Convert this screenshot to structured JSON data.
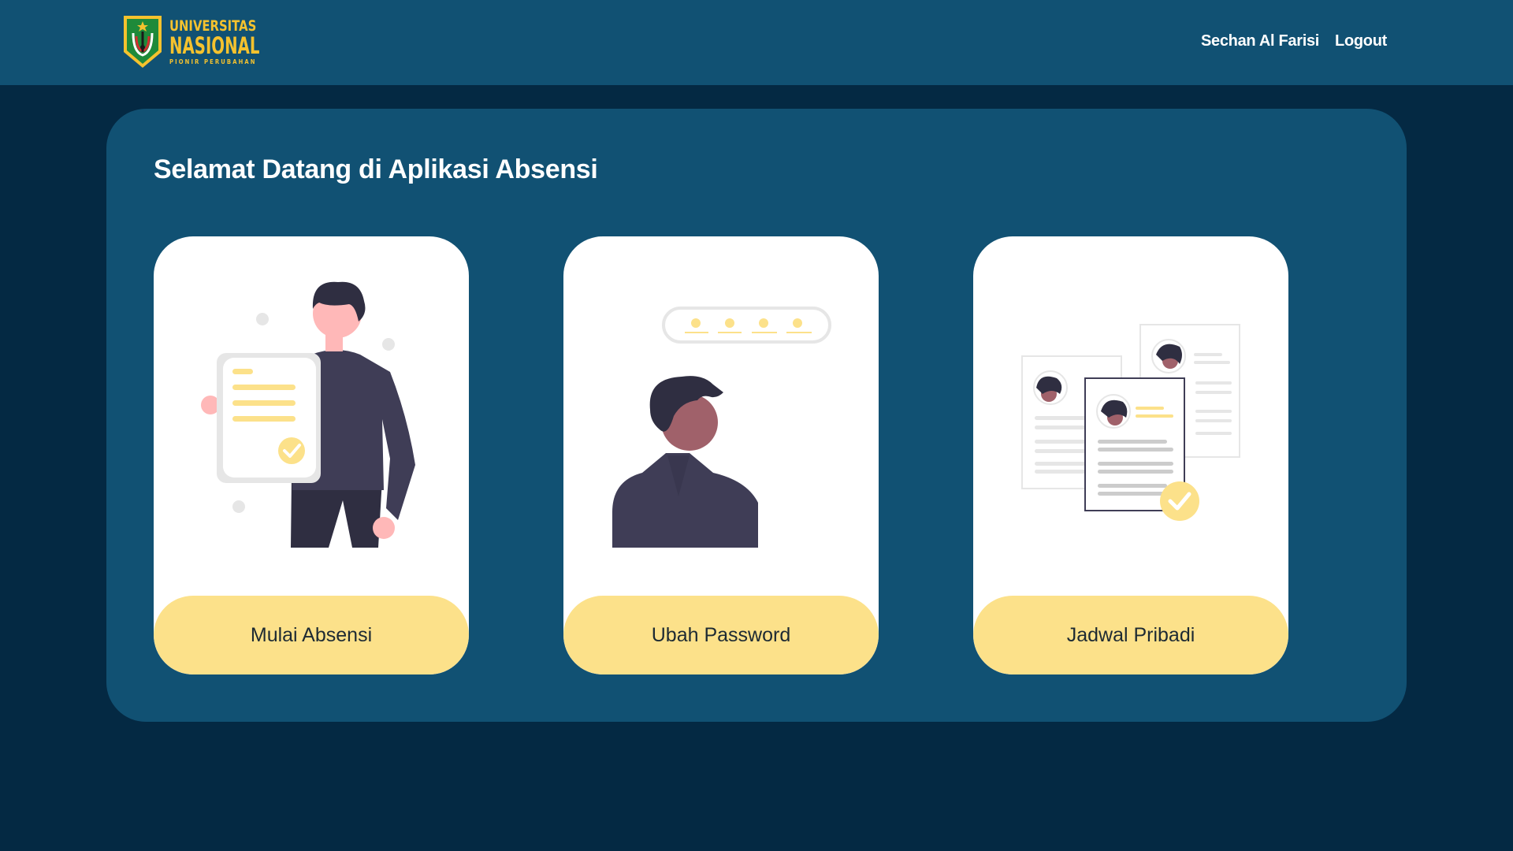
{
  "navbar": {
    "logo": {
      "line1": "UNIVERSITAS",
      "line2": "NASIONAL",
      "line3": "PIONIR PERUBAHAN",
      "icon": "university-shield-emblem"
    },
    "user_name": "Sechan Al Farisi",
    "logout_label": "Logout"
  },
  "main": {
    "welcome_title": "Selamat Datang di Aplikasi Absensi",
    "cards": [
      {
        "label": "Mulai Absensi",
        "illustration": "person-holding-document-illustration"
      },
      {
        "label": "Ubah Password",
        "illustration": "person-with-password-field-illustration"
      },
      {
        "label": "Jadwal Pribadi",
        "illustration": "profile-documents-checked-illustration"
      }
    ]
  },
  "colors": {
    "page_bg": "#042943",
    "navbar_bg": "#115173",
    "panel_bg": "#115173",
    "card_bg": "#FFFFFF",
    "button_bg": "#FCE18A",
    "logo_gold": "#F5C22E",
    "logo_green": "#1E8A3A"
  }
}
